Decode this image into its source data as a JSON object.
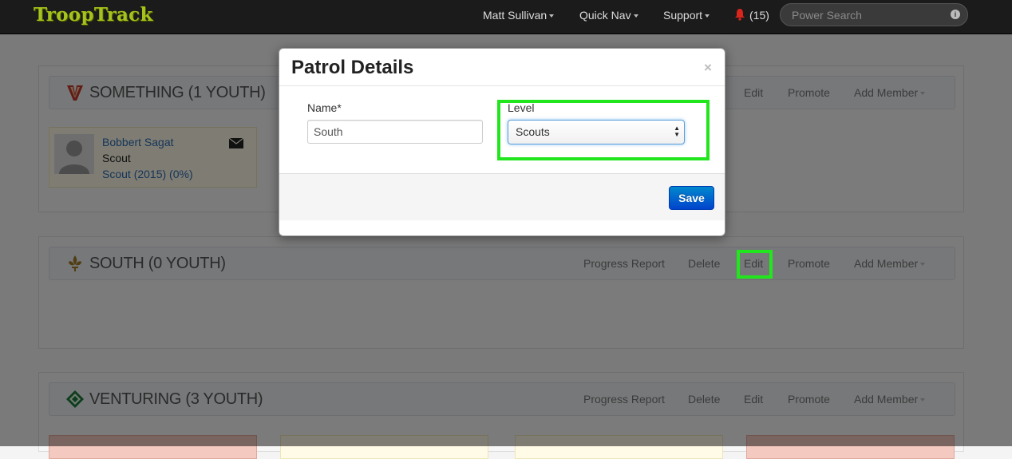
{
  "nav": {
    "brand": "TroopTrack",
    "user": "Matt Sullivan",
    "quick_nav": "Quick Nav",
    "support": "Support",
    "notifications": "(15)",
    "search_placeholder": "Power Search"
  },
  "patrols": [
    {
      "title": "SOMETHING (1 YOUTH)",
      "actions": [
        "Edit",
        "Promote",
        "Add Member"
      ],
      "members": [
        {
          "name": "Bobbert Sagat",
          "rank": "Scout",
          "level": "Scout (2015) (0%)"
        }
      ]
    },
    {
      "title": "SOUTH (0 YOUTH)",
      "actions": [
        "Progress Report",
        "Delete",
        "Edit",
        "Promote",
        "Add Member"
      ]
    },
    {
      "title": "VENTURING (3 YOUTH)",
      "actions": [
        "Progress Report",
        "Delete",
        "Edit",
        "Promote",
        "Add Member"
      ]
    }
  ],
  "modal": {
    "title": "Patrol Details",
    "close": "×",
    "name_label": "Name*",
    "name_value": "South",
    "level_label": "Level",
    "level_value": "Scouts",
    "save": "Save"
  },
  "colors": {
    "highlight": "#22e61d",
    "brand": "#a6c21c",
    "save": "#0055cc"
  }
}
